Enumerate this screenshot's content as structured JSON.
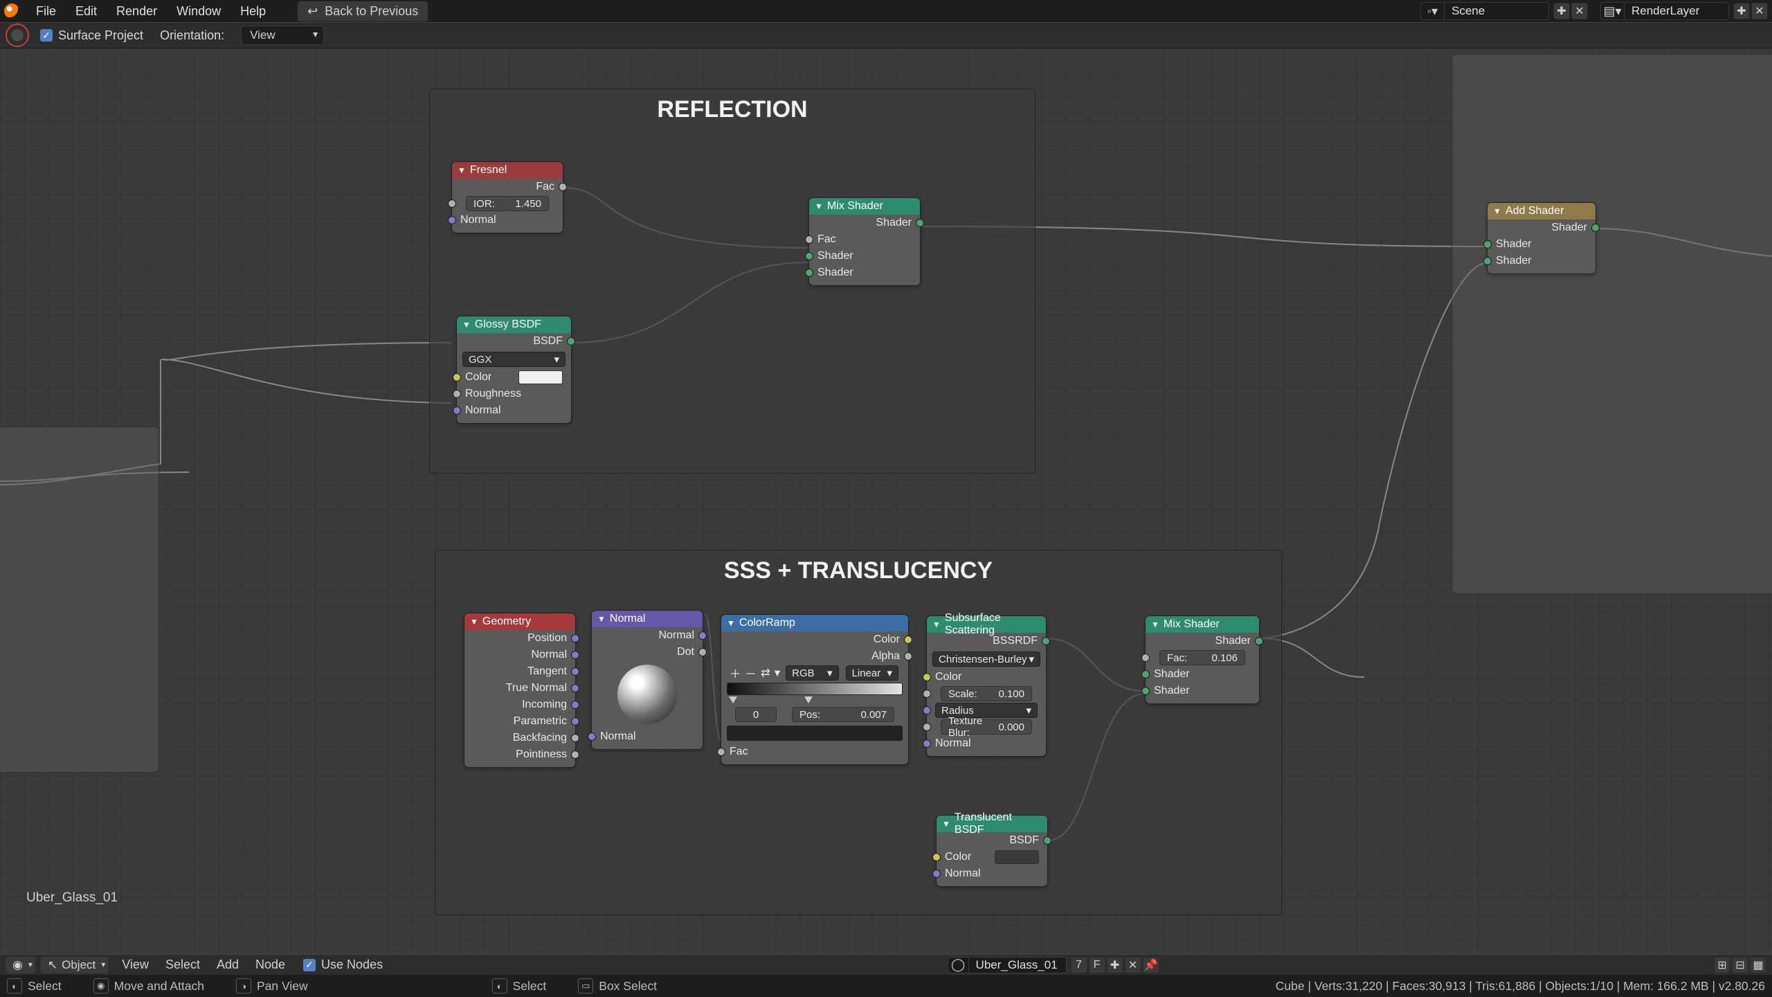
{
  "menu": {
    "file": "File",
    "edit": "Edit",
    "render": "Render",
    "window": "Window",
    "help": "Help"
  },
  "back_prev": "Back to Previous",
  "scene_name": "Scene",
  "layer_name": "RenderLayer",
  "toolbar": {
    "surface_project": "Surface Project",
    "orientation_label": "Orientation:",
    "orientation_value": "View"
  },
  "frames": {
    "reflection": "REFLECTION",
    "sss": "SSS + TRANSLUCENCY"
  },
  "nodes": {
    "fresnel": {
      "title": "Fresnel",
      "out_fac": "Fac",
      "ior_label": "IOR:",
      "ior_value": "1.450",
      "normal": "Normal"
    },
    "glossy": {
      "title": "Glossy BSDF",
      "out": "BSDF",
      "dist": "GGX",
      "color": "Color",
      "rough": "Roughness",
      "normal": "Normal"
    },
    "mix1": {
      "title": "Mix Shader",
      "out": "Shader",
      "fac": "Fac",
      "sh1": "Shader",
      "sh2": "Shader"
    },
    "add": {
      "title": "Add Shader",
      "out": "Shader",
      "sh1": "Shader",
      "sh2": "Shader"
    },
    "geom": {
      "title": "Geometry",
      "outs": [
        "Position",
        "Normal",
        "Tangent",
        "True Normal",
        "Incoming",
        "Parametric",
        "Backfacing",
        "Pointiness"
      ]
    },
    "normal": {
      "title": "Normal",
      "out_n": "Normal",
      "out_d": "Dot",
      "in_n": "Normal"
    },
    "ramp": {
      "title": "ColorRamp",
      "out_c": "Color",
      "out_a": "Alpha",
      "mode": "RGB",
      "interp": "Linear",
      "idx": "0",
      "pos_l": "Pos:",
      "pos_v": "0.007",
      "fac": "Fac"
    },
    "sss": {
      "title": "Subsurface Scattering",
      "out": "BSSRDF",
      "falloff": "Christensen-Burley",
      "color": "Color",
      "scale_l": "Scale:",
      "scale_v": "0.100",
      "radius": "Radius",
      "blur_l": "Texture Blur:",
      "blur_v": "0.000",
      "normal": "Normal"
    },
    "trans": {
      "title": "Translucent BSDF",
      "out": "BSDF",
      "color": "Color",
      "normal": "Normal"
    },
    "mix2": {
      "title": "Mix Shader",
      "out": "Shader",
      "fac_l": "Fac:",
      "fac_v": "0.106",
      "sh1": "Shader",
      "sh2": "Shader"
    }
  },
  "material_label": "Uber_Glass_01",
  "footer1": {
    "mode": "Object",
    "view": "View",
    "select": "Select",
    "add": "Add",
    "node": "Node",
    "use_nodes": "Use Nodes",
    "material": "Uber_Glass_01",
    "users": "7",
    "fake": "F"
  },
  "footer2": {
    "select": "Select",
    "move": "Move and Attach",
    "pan": "Pan View",
    "sel2": "Select",
    "box": "Box Select",
    "stats": "Cube | Verts:31,220 | Faces:30,913 | Tris:61,886 | Objects:1/10 | Mem: 166.2 MB | v2.80.26"
  }
}
